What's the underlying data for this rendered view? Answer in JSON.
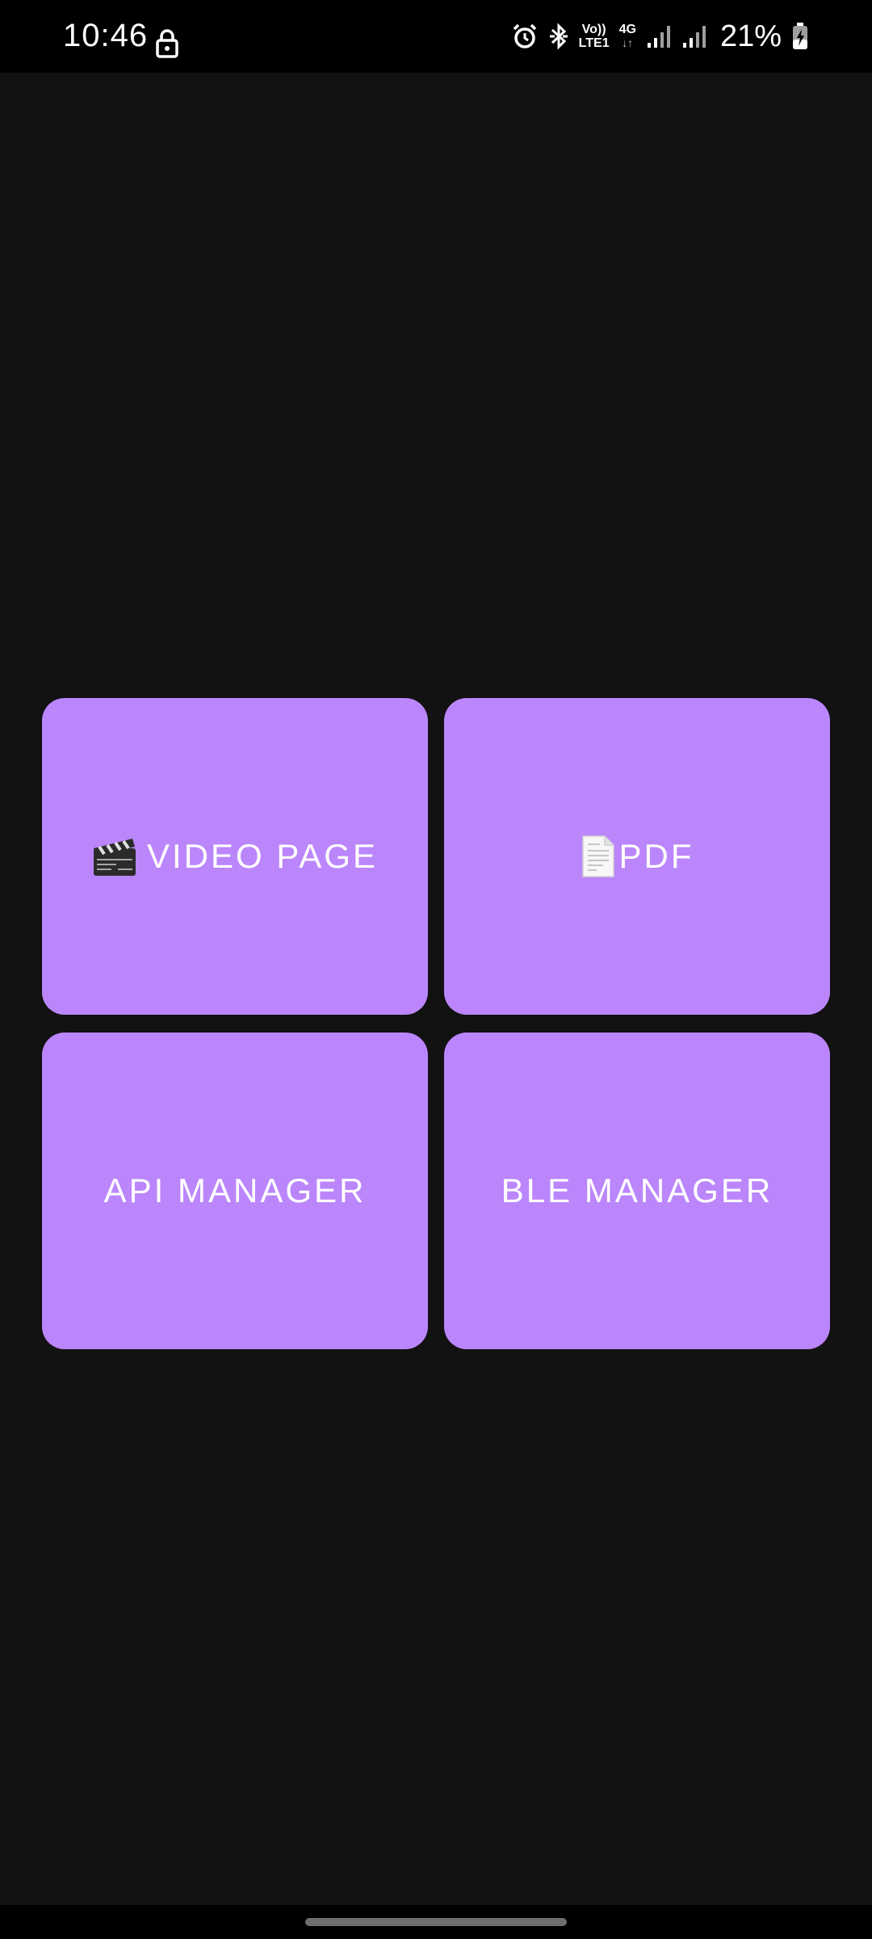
{
  "status_bar": {
    "time": "10:46",
    "volte_top": "Vo))",
    "volte_bottom": "LTE1",
    "network_type": "4G",
    "network_arrows": "↓↑",
    "battery_percent": "21%",
    "icons": [
      "lock-icon",
      "alarm-icon",
      "bluetooth-icon",
      "signal-icon",
      "signal-icon",
      "battery-charging-icon"
    ]
  },
  "menu": {
    "tiles": [
      {
        "label": "VIDEO PAGE",
        "icon": "clapperboard-icon"
      },
      {
        "label": "PDF",
        "icon": "document-icon"
      },
      {
        "label": "API MANAGER",
        "icon": ""
      },
      {
        "label": "BLE MANAGER",
        "icon": ""
      }
    ]
  },
  "colors": {
    "background": "#121212",
    "tile": "#bb86fc",
    "tile_text": "#ffffff",
    "status_bar": "#000000"
  }
}
